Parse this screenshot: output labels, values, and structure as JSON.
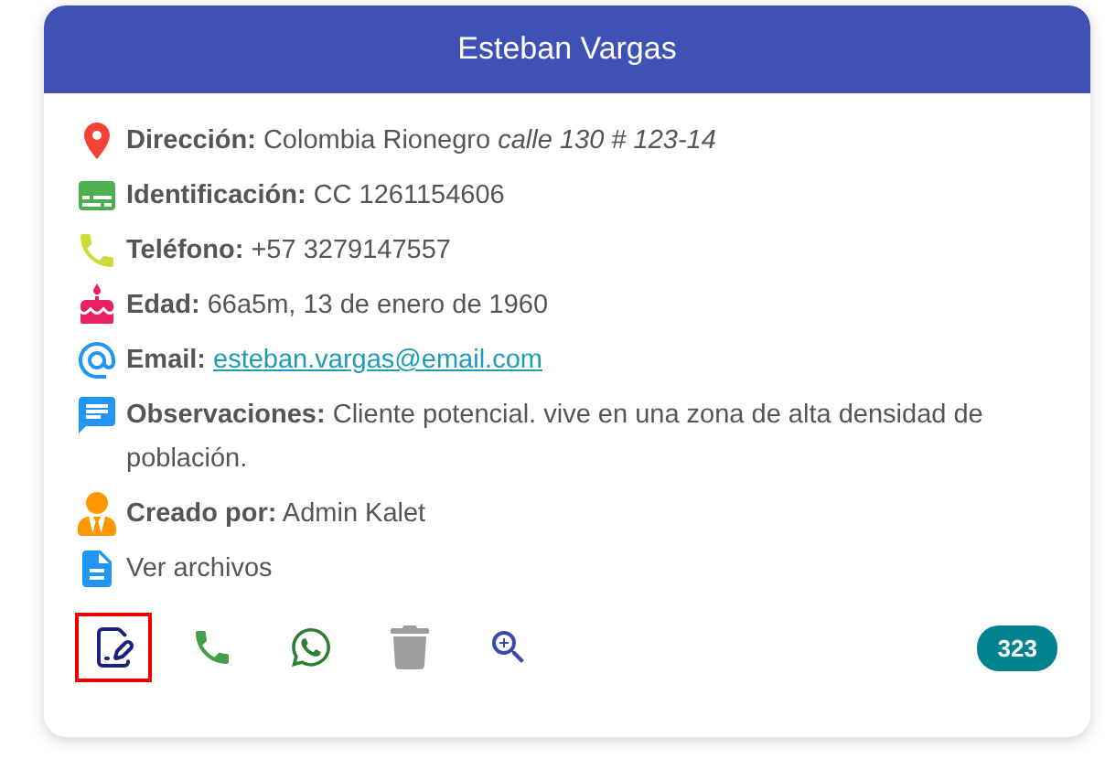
{
  "card": {
    "title": "Esteban Vargas",
    "fields": [
      {
        "kind": "labeled",
        "label": "Dirección:",
        "value": "Colombia Rionegro *calle 130 # 123-14*"
      },
      {
        "kind": "labeled",
        "label": "Identificación:",
        "value": "CC 1261154606"
      },
      {
        "kind": "labeled",
        "label": "Teléfono:",
        "value": "+57 3279147557"
      },
      {
        "kind": "labeled",
        "label": "Edad:",
        "value": "66a5m, 13 de enero de 1960"
      },
      {
        "kind": "link",
        "label": "Email:",
        "value": "esteban.vargas@email.com"
      },
      {
        "kind": "labeled",
        "label": "Observaciones:",
        "value": "Cliente potencial. vive en una zona de alta densidad de población."
      },
      {
        "kind": "labeled",
        "label": "Creado por:",
        "value": "Admin Kalet"
      },
      {
        "kind": "plain",
        "value": "Ver archivos"
      }
    ],
    "actions": [
      {
        "selected": true
      },
      {
        "selected": false
      },
      {
        "selected": false
      },
      {
        "selected": false
      },
      {
        "selected": false
      }
    ],
    "badge": "323"
  }
}
